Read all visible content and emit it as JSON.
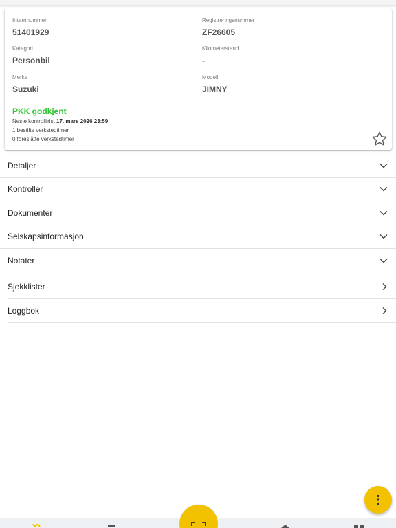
{
  "vehicle": {
    "fields": [
      {
        "label": "Internnummer",
        "value": "51401929"
      },
      {
        "label": "Registreringsnummer",
        "value": "ZF26605"
      },
      {
        "label": "Kategori",
        "value": "Personbil"
      },
      {
        "label": "Kilometerstand",
        "value": "-"
      },
      {
        "label": "Merke",
        "value": "Suzuki"
      },
      {
        "label": "Modell",
        "value": "JIMNY"
      }
    ],
    "status": {
      "title": "PKK godkjent",
      "next_prefix": "Neste kontrollfrist",
      "next_date": "17. mars 2026 23:59",
      "ordered_hours": "1 bestilte verkstedtimer",
      "suggested_hours": "0 foreslåtte verkstedtimer"
    }
  },
  "sections": [
    {
      "label": "Detaljer"
    },
    {
      "label": "Kontroller"
    },
    {
      "label": "Dokumenter"
    },
    {
      "label": "Selskapsinformasjon"
    },
    {
      "label": "Notater"
    }
  ],
  "links": [
    {
      "label": "Sjekklister"
    },
    {
      "label": "Loggbok"
    }
  ],
  "colors": {
    "accent": "#f2c200",
    "success": "#2fc52f"
  },
  "icons": {
    "favorite": "star-outline-icon",
    "expand": "chevron-down-icon",
    "navigate": "chevron-right-icon",
    "more": "more-vert-icon",
    "scan": "scan-icon"
  }
}
